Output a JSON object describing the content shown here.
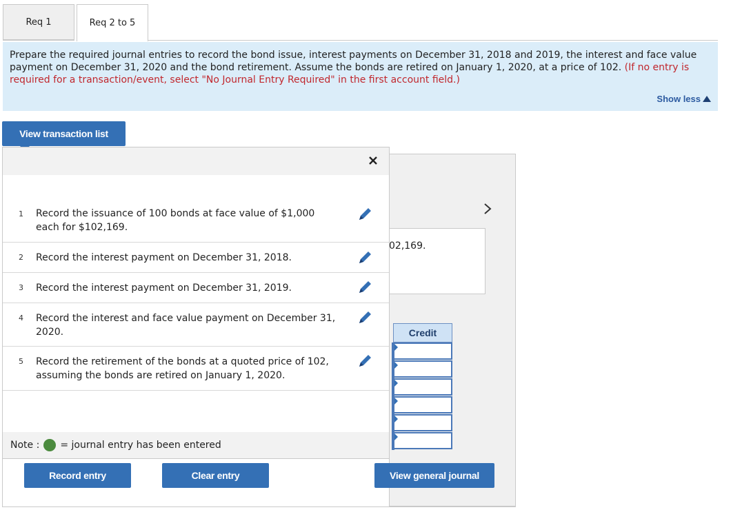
{
  "tabs": [
    {
      "label": "Req 1"
    },
    {
      "label": "Req 2 to 5"
    }
  ],
  "instructions": {
    "text": "Prepare the required journal entries to record the bond issue, interest payments on December 31, 2018 and 2019, the interest and face value payment on December 31, 2020 and the bond retirement. Assume the bonds are retired on January 1, 2020, at a price of 102.",
    "note": "(If no entry is required for a transaction/event, select \"No Journal Entry Required\" in the first account field.)",
    "show_less": "Show less"
  },
  "view_transaction_list": "View transaction list",
  "background": {
    "partial_amount": "02,169.",
    "credit_header": "Credit"
  },
  "transactions": [
    {
      "num": "1",
      "text": "Record the issuance of 100 bonds at face value of $1,000 each for $102,169."
    },
    {
      "num": "2",
      "text": "Record the interest payment on December 31, 2018."
    },
    {
      "num": "3",
      "text": "Record the interest payment on December 31, 2019."
    },
    {
      "num": "4",
      "text": "Record the interest and face value payment on December 31, 2020."
    },
    {
      "num": "5",
      "text": "Record the retirement of the bonds at a quoted price of 102, assuming the bonds are retired on January 1, 2020."
    }
  ],
  "note": {
    "label": "Note :",
    "text": "= journal entry has been entered"
  },
  "buttons": {
    "record": "Record entry",
    "clear": "Clear entry",
    "journal": "View general journal"
  },
  "icons": {
    "close": "close-icon",
    "edit": "pencil-icon",
    "next": "chevron-right-icon"
  },
  "colors": {
    "accent": "#3470b5",
    "instruction_bg": "#dbedf9",
    "warning_text": "#c1272d",
    "entered_dot": "#4b8a3e"
  }
}
